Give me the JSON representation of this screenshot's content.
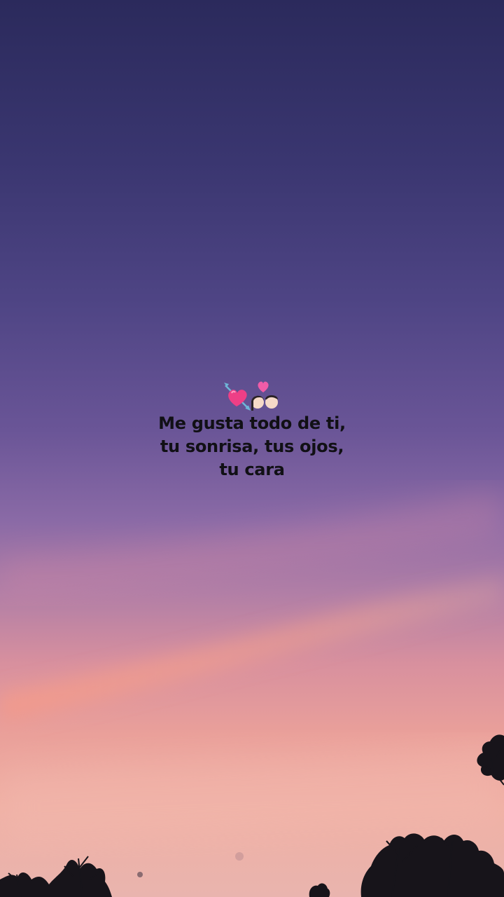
{
  "story": {
    "emojis": [
      "heart-with-arrow",
      "couple-with-heart"
    ],
    "caption_lines": [
      "Me gusta todo de ti,",
      "tu sonrisa, tus ojos,",
      "tu cara"
    ]
  },
  "colors": {
    "sky_top": "#2b2a5c",
    "sky_mid": "#6a5597",
    "sky_bottom": "#efb0a4",
    "text": "#111015"
  }
}
